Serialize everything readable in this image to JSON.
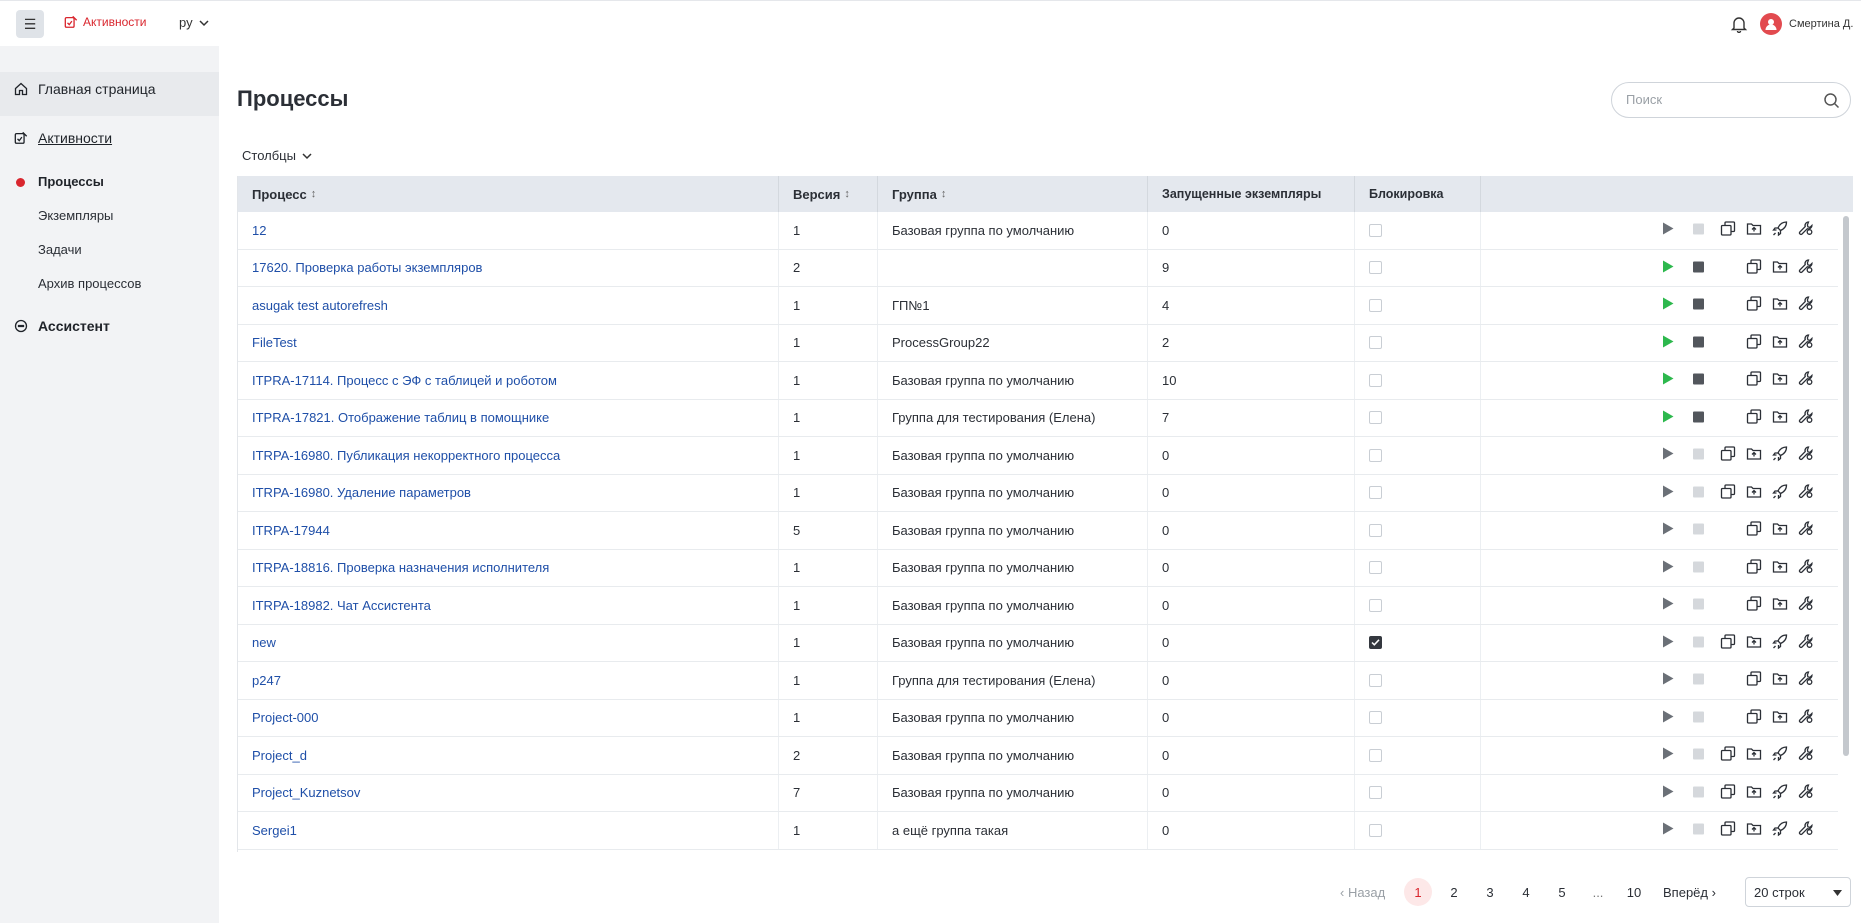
{
  "header": {
    "brand": "Активности",
    "lang": "ру",
    "username": "Смертина Д."
  },
  "sidebar": {
    "home": "Главная страница",
    "activities": "Активности",
    "sub": [
      "Процессы",
      "Экземпляры",
      "Задачи",
      "Архив процессов"
    ],
    "assistant": "Ассистент"
  },
  "main": {
    "title": "Процессы",
    "search_placeholder": "Поиск",
    "columns_label": "Столбцы"
  },
  "table": {
    "headers": [
      "Процесс",
      "Версия",
      "Группа",
      "Запущенные экземпляры",
      "Блокировка"
    ],
    "rows": [
      {
        "name": "12",
        "version": "1",
        "group": "Базовая группа по умолчанию",
        "running": "0",
        "locked": false,
        "active": false,
        "full": true
      },
      {
        "name": "17620. Проверка работы экземпляров",
        "version": "2",
        "group": "",
        "running": "9",
        "locked": false,
        "active": true,
        "full": false
      },
      {
        "name": "asugak test autorefresh",
        "version": "1",
        "group": "ГП№1",
        "running": "4",
        "locked": false,
        "active": true,
        "full": false
      },
      {
        "name": "FileTest",
        "version": "1",
        "group": "ProcessGroup22",
        "running": "2",
        "locked": false,
        "active": true,
        "full": false
      },
      {
        "name": "ITPRA-17114. Процесс с ЭФ с таблицей и роботом",
        "version": "1",
        "group": "Базовая группа по умолчанию",
        "running": "10",
        "locked": false,
        "active": true,
        "full": false
      },
      {
        "name": "ITPRA-17821. Отображение таблиц в помощнике",
        "version": "1",
        "group": "Группа для тестирования (Елена)",
        "running": "7",
        "locked": false,
        "active": true,
        "full": false
      },
      {
        "name": "ITRPA-16980. Публикация некорректного процесса",
        "version": "1",
        "group": "Базовая группа по умолчанию",
        "running": "0",
        "locked": false,
        "active": false,
        "full": true
      },
      {
        "name": "ITRPA-16980. Удаление параметров",
        "version": "1",
        "group": "Базовая группа по умолчанию",
        "running": "0",
        "locked": false,
        "active": false,
        "full": true
      },
      {
        "name": "ITRPA-17944",
        "version": "5",
        "group": "Базовая группа по умолчанию",
        "running": "0",
        "locked": false,
        "active": false,
        "full": false
      },
      {
        "name": "ITRPA-18816. Проверка назначения исполнителя",
        "version": "1",
        "group": "Базовая группа по умолчанию",
        "running": "0",
        "locked": false,
        "active": false,
        "full": false
      },
      {
        "name": "ITRPA-18982. Чат Ассистента",
        "version": "1",
        "group": "Базовая группа по умолчанию",
        "running": "0",
        "locked": false,
        "active": false,
        "full": false
      },
      {
        "name": "new",
        "version": "1",
        "group": "Базовая группа по умолчанию",
        "running": "0",
        "locked": true,
        "active": false,
        "full": true
      },
      {
        "name": "p247",
        "version": "1",
        "group": "Группа для тестирования (Елена)",
        "running": "0",
        "locked": false,
        "active": false,
        "full": false
      },
      {
        "name": "Project-000",
        "version": "1",
        "group": "Базовая группа по умолчанию",
        "running": "0",
        "locked": false,
        "active": false,
        "full": false
      },
      {
        "name": "Project_d",
        "version": "2",
        "group": "Базовая группа по умолчанию",
        "running": "0",
        "locked": false,
        "active": false,
        "full": true
      },
      {
        "name": "Project_Kuznetsov",
        "version": "7",
        "group": "Базовая группа по умолчанию",
        "running": "0",
        "locked": false,
        "active": false,
        "full": true
      },
      {
        "name": "Sergei1",
        "version": "1",
        "group": "а ещё группа такая",
        "running": "0",
        "locked": false,
        "active": false,
        "full": true
      }
    ]
  },
  "pagination": {
    "prev": "Назад",
    "pages": [
      "1",
      "2",
      "3",
      "4",
      "5",
      "...",
      "10"
    ],
    "next": "Вперёд",
    "rows_per_page": "20 строк"
  },
  "colors": {
    "accent": "#d9262e",
    "link": "#1f4fa8",
    "play_active": "#2db84d"
  }
}
